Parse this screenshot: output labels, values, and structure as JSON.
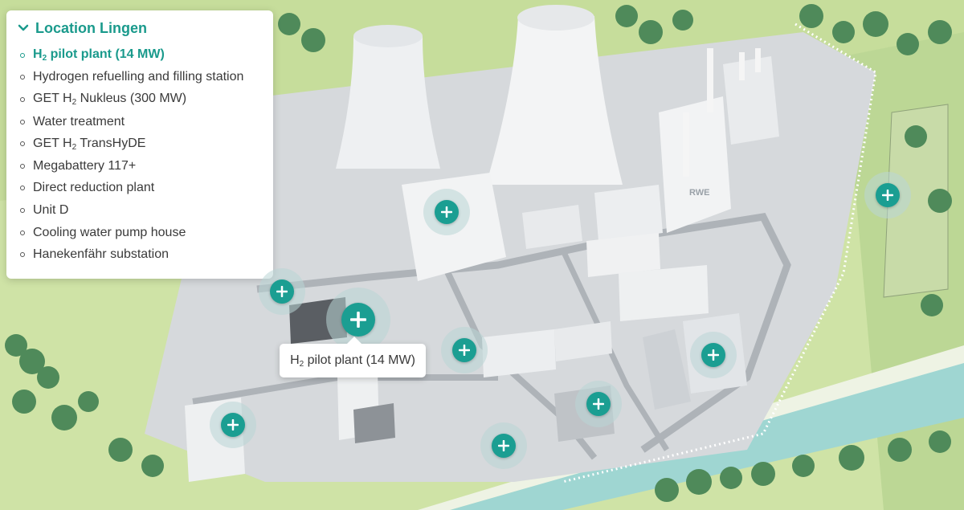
{
  "panel": {
    "title": "Location Lingen",
    "items": [
      {
        "pre": "H",
        "sub": "2",
        "post": " pilot plant (14 MW)",
        "active": true
      },
      {
        "pre": "Hydrogen refuelling and filling station",
        "sub": "",
        "post": "",
        "active": false
      },
      {
        "pre": "GET H",
        "sub": "2",
        "post": " Nukleus (300 MW)",
        "active": false
      },
      {
        "pre": "Water treatment",
        "sub": "",
        "post": "",
        "active": false
      },
      {
        "pre": "GET H",
        "sub": "2",
        "post": " TransHyDE",
        "active": false
      },
      {
        "pre": "Megabattery 117+",
        "sub": "",
        "post": "",
        "active": false
      },
      {
        "pre": "Direct reduction plant",
        "sub": "",
        "post": "",
        "active": false
      },
      {
        "pre": "Unit D",
        "sub": "",
        "post": "",
        "active": false
      },
      {
        "pre": "Cooling water pump house",
        "sub": "",
        "post": "",
        "active": false
      },
      {
        "pre": "Hanekenfähr substation",
        "sub": "",
        "post": "",
        "active": false
      }
    ]
  },
  "tooltip": {
    "pre": "H",
    "sub": "2",
    "post": " pilot plant (14 MW)"
  },
  "building_sign": "RWE",
  "colors": {
    "accent": "#1a9a8c",
    "hotspot": "#1b9e92",
    "grass": "#cfe3a6",
    "ground": "#d6d9dc",
    "river": "#9fd6d2",
    "trees": "#4f8a5a"
  },
  "icons": {
    "expand": "chevron-down-icon",
    "hotspot": "plus-icon"
  }
}
